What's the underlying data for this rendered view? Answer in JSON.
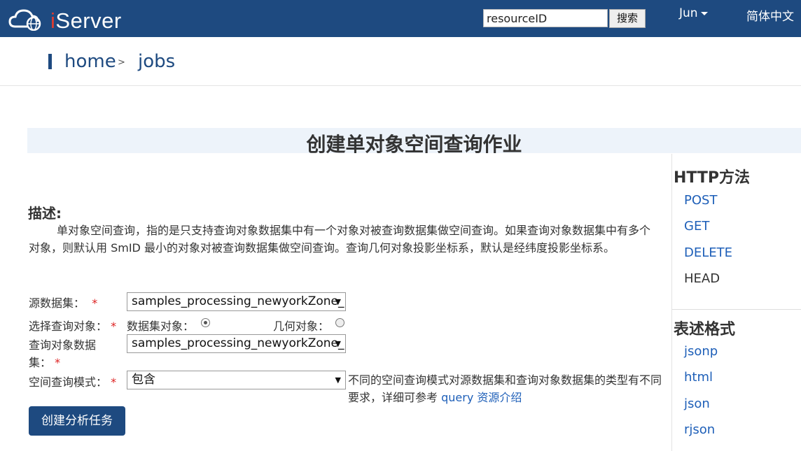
{
  "header": {
    "logo_prefix": "i",
    "logo_text": "Server",
    "search_value": "resourceID",
    "search_button": "搜索",
    "user_menu": "Jun",
    "language_menu": "简体中文"
  },
  "breadcrumb": {
    "home": "home",
    "separator": ">",
    "current": "jobs"
  },
  "page_title": "创建单对象空间查询作业",
  "description": {
    "heading": "描述:",
    "text": "单对象空间查询，指的是只支持查询对象数据集中有一个对象对被查询数据集做空间查询。如果查询对象数据集中有多个对象，则默认用 SmID 最小的对象对被查询数据集做空间查询。查询几何对象投影坐标系，默认是经纬度投影坐标系。"
  },
  "form": {
    "source_label": "源数据集：",
    "required_mark": "*",
    "source_value": "samples_processing_newyorkZone_R",
    "query_object_label": "选择查询对象：",
    "radio_dataset_label": "数据集对象：",
    "radio_geometry_label": "几何对象：",
    "query_dataset_label_1": "查询对象数据",
    "query_dataset_label_2": "集：",
    "query_dataset_value": "samples_processing_newyorkZone_R",
    "mode_label": "空间查询模式：",
    "mode_value": "包含",
    "hint_text": "不同的空间查询模式对源数据集和查询对象数据集的类型有不同要求，详细可参考 ",
    "hint_link": "query 资源介绍",
    "create_button": "创建分析任务"
  },
  "sidebar": {
    "http_heading": "HTTP方法",
    "methods": [
      "POST",
      "GET",
      "DELETE",
      "HEAD"
    ],
    "format_heading": "表述格式",
    "formats": [
      "jsonp",
      "html",
      "json",
      "rjson"
    ]
  },
  "colors": {
    "brand": "#1e4a80",
    "link": "#1e5fb8",
    "required": "#dd2222",
    "title_band": "#edf3fa"
  }
}
